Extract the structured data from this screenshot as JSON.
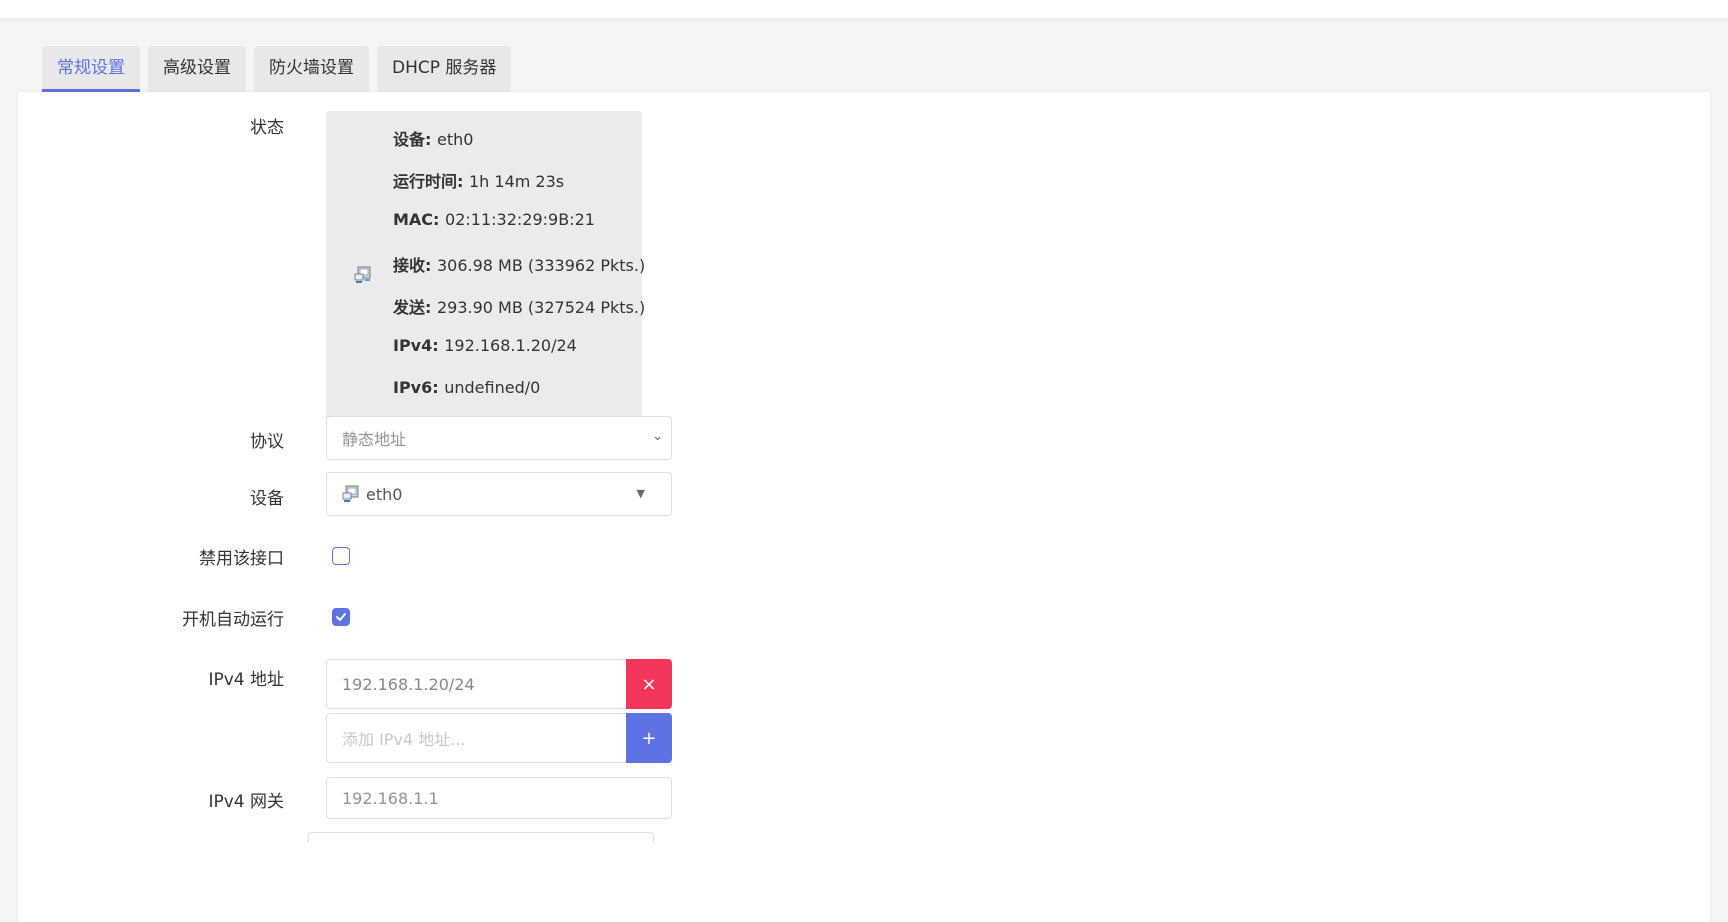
{
  "tabs": [
    {
      "label": "常规设置",
      "active": true
    },
    {
      "label": "高级设置",
      "active": false
    },
    {
      "label": "防火墙设置",
      "active": false
    },
    {
      "label": "DHCP 服务器",
      "active": false
    }
  ],
  "status": {
    "label": "状态",
    "icon": "network-adapter-icon",
    "lines": [
      {
        "key": "设备",
        "sep": ": ",
        "value": "eth0"
      },
      {
        "key": "运行时间",
        "sep": ": ",
        "value": "1h 14m 23s"
      },
      {
        "key": "MAC",
        "sep": ": ",
        "value": "02:11:32:29:9B:21"
      },
      {
        "key": "接收",
        "sep": ": ",
        "value": "306.98 MB (333962 Pkts.)"
      },
      {
        "key": "发送",
        "sep": ": ",
        "value": "293.90 MB (327524 Pkts.)"
      },
      {
        "key": "IPv4",
        "sep": ": ",
        "value": "192.168.1.20/24"
      },
      {
        "key": "IPv6",
        "sep": ": ",
        "value": "undefined/0"
      }
    ]
  },
  "protocol": {
    "label": "协议",
    "value": "静态地址"
  },
  "device": {
    "label": "设备",
    "value": "eth0"
  },
  "disable_interface": {
    "label": "禁用该接口",
    "checked": false
  },
  "autostart": {
    "label": "开机自动运行",
    "checked": true
  },
  "ipv4_address": {
    "label": "IPv4 地址",
    "value": "192.168.1.20/24",
    "remove_label": "×",
    "add_placeholder": "添加 IPv4 地址...",
    "add_label": "+"
  },
  "ipv4_gateway": {
    "label": "IPv4 网关",
    "value": "192.168.1.1"
  },
  "colors": {
    "accent": "#5e72e4",
    "danger": "#f5365c"
  }
}
